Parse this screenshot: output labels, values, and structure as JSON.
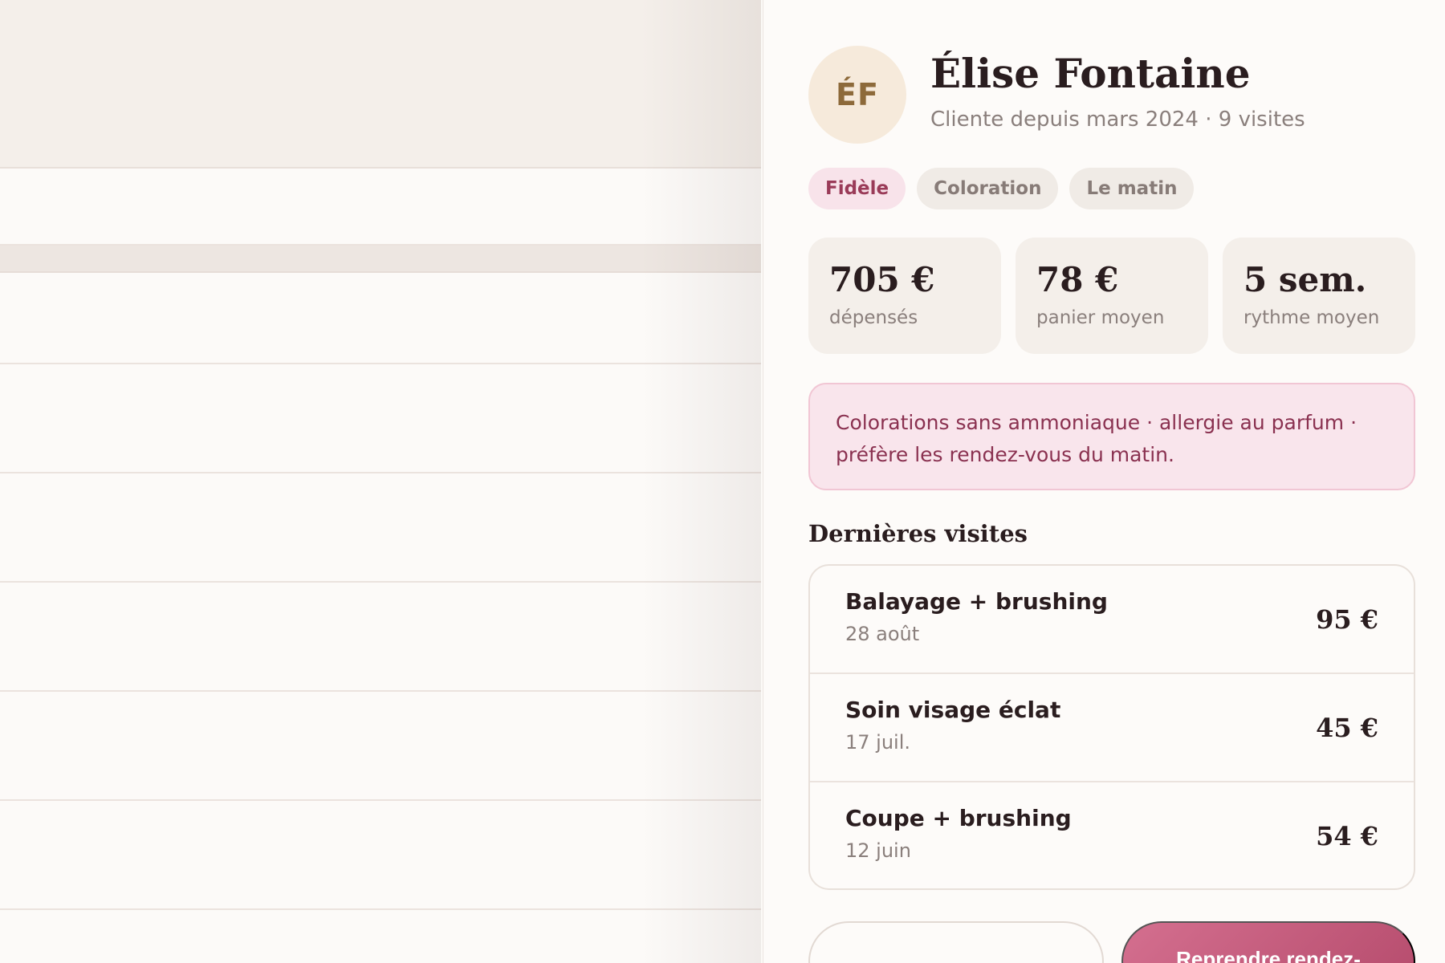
{
  "client": {
    "initials": "ÉF",
    "name": "Élise Fontaine",
    "subtitle": "Cliente depuis mars 2024 · 9 visites"
  },
  "tags": [
    {
      "label": "Fidèle"
    },
    {
      "label": "Coloration"
    },
    {
      "label": "Le matin"
    }
  ],
  "stats": [
    {
      "value": "705 €",
      "label": "dépensés"
    },
    {
      "value": "78 €",
      "label": "panier moyen"
    },
    {
      "value": "5 sem.",
      "label": "rythme moyen"
    }
  ],
  "note": "Colorations sans ammoniaque · allergie au parfum · préfère les rendez-vous du matin.",
  "visits_section": {
    "title": "Dernières visites",
    "items": [
      {
        "service": "Balayage + brushing",
        "date": "28 août",
        "price": "95 €"
      },
      {
        "service": "Soin visage éclat",
        "date": "17 juil.",
        "price": "45 €"
      },
      {
        "service": "Coupe + brushing",
        "date": "12 juin",
        "price": "54 €"
      }
    ]
  },
  "actions": {
    "secondary_label": "",
    "primary_label": "Reprendre rendez-"
  },
  "colors": {
    "accent": "#c45d7e",
    "tag_primary_bg": "#f8e3ea",
    "note_bg": "#f9e5ec",
    "avatar_bg": "#f6eadb"
  }
}
